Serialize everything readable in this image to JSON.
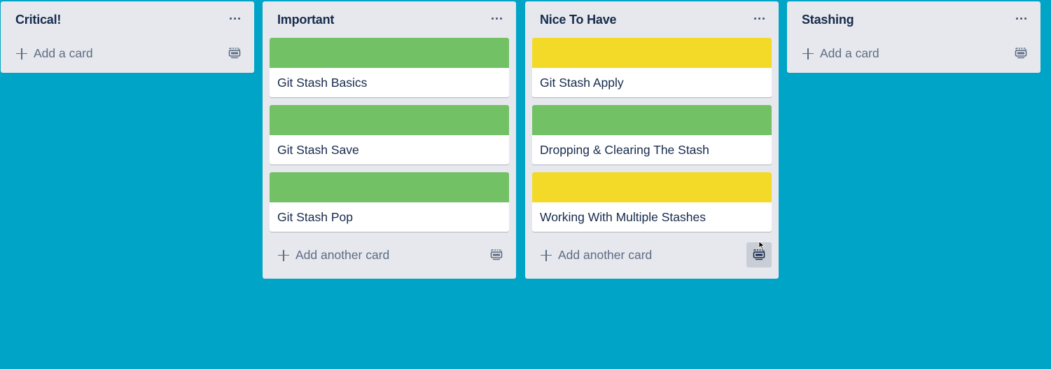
{
  "colors": {
    "board_background": "#00a4c7",
    "list_background": "#e6e8ed",
    "label_green": "#72c165",
    "label_yellow": "#f3d928"
  },
  "lists": [
    {
      "title": "Critical!",
      "menu_icon": "more-horizontal-icon",
      "cards": [],
      "add_label": "Add a card",
      "template_icon": "card-template-icon"
    },
    {
      "title": "Important",
      "menu_icon": "more-horizontal-icon",
      "cards": [
        {
          "title": "Git Stash Basics",
          "cover_color": "#72c165"
        },
        {
          "title": "Git Stash Save",
          "cover_color": "#72c165"
        },
        {
          "title": "Git Stash Pop",
          "cover_color": "#72c165"
        }
      ],
      "add_label": "Add another card",
      "template_icon": "card-template-icon"
    },
    {
      "title": "Nice To Have",
      "menu_icon": "more-horizontal-icon",
      "cards": [
        {
          "title": "Git Stash Apply",
          "cover_color": "#f3d928"
        },
        {
          "title": "Dropping & Clearing The Stash",
          "cover_color": "#72c165"
        },
        {
          "title": "Working With Multiple Stashes",
          "cover_color": "#f3d928"
        }
      ],
      "add_label": "Add another card",
      "template_icon": "card-template-icon"
    },
    {
      "title": "Stashing",
      "menu_icon": "more-horizontal-icon",
      "cards": [],
      "add_label": "Add a card",
      "template_icon": "card-template-icon"
    }
  ]
}
